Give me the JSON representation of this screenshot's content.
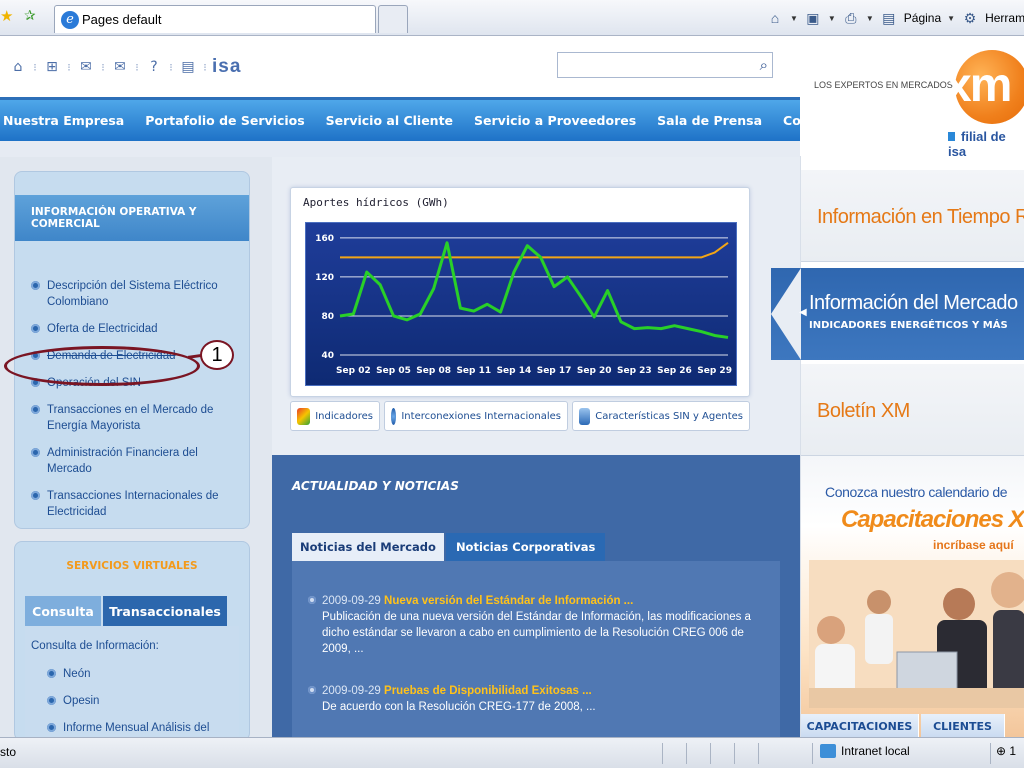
{
  "browser": {
    "tab_title": "Pages default",
    "cmd": {
      "pagina": "Página",
      "herramientas": "Herram"
    },
    "status_text": "sto",
    "zone": "Intranet local",
    "zoom": "1"
  },
  "header": {
    "isa_logo": "isa",
    "slogan": "LOS EXPERTOS EN MERCADOS",
    "brand": "xm",
    "filial": "filial de isa"
  },
  "nav": {
    "items": [
      "Nuestra Empresa",
      "Portafolio de Servicios",
      "Servicio al Cliente",
      "Servicio a Proveedores",
      "Sala de Prensa",
      "Contáctenos"
    ]
  },
  "left": {
    "panel_title": "INFORMACIÓN OPERATIVA Y COMERCIAL",
    "menu": [
      "Descripción del Sistema Eléctrico Colombiano",
      "Oferta de Electricidad",
      "Demanda de Electricidad",
      "Operación del SIN",
      "Transacciones en el Mercado de Energía Mayorista",
      "Administración Financiera del Mercado",
      "Transacciones Internacionales de Electricidad"
    ],
    "annotation": "1",
    "services_title": "SERVICIOS VIRTUALES",
    "tabs": [
      "Consulta",
      "Transaccionales"
    ],
    "consulta_label": "Consulta de Información:",
    "services": [
      "Neón",
      "Opesin",
      "Informe Mensual Análisis del"
    ]
  },
  "chart_data": {
    "type": "line",
    "title": "Aportes hídricos (GWh)",
    "categories": [
      "Sep 02",
      "Sep 05",
      "Sep 08",
      "Sep 11",
      "Sep 14",
      "Sep 17",
      "Sep 20",
      "Sep 23",
      "Sep 26",
      "Sep 29"
    ],
    "x_days": [
      1,
      2,
      3,
      4,
      5,
      6,
      7,
      8,
      9,
      10,
      11,
      12,
      13,
      14,
      15,
      16,
      17,
      18,
      19,
      20,
      21,
      22,
      23,
      24,
      25,
      26,
      27,
      28,
      29,
      30
    ],
    "yticks": [
      40,
      80,
      120,
      160
    ],
    "ylim": [
      40,
      165
    ],
    "series": [
      {
        "color": "#29d028",
        "values": [
          80,
          82,
          125,
          112,
          80,
          76,
          82,
          108,
          155,
          88,
          85,
          92,
          84,
          125,
          152,
          140,
          110,
          120,
          100,
          79,
          106,
          74,
          67,
          68,
          67,
          70,
          67,
          64,
          60,
          58
        ]
      },
      {
        "color": "#f2a516",
        "values": [
          140,
          140,
          140,
          140,
          140,
          140,
          140,
          140,
          140,
          140,
          140,
          140,
          140,
          140,
          140,
          140,
          140,
          140,
          140,
          140,
          140,
          140,
          140,
          140,
          140,
          140,
          140,
          140,
          145,
          155
        ]
      }
    ],
    "grid": true
  },
  "quick_links": [
    "Indicadores",
    "Interconexiones Internacionales",
    "Características SIN y Agentes"
  ],
  "news": {
    "section_title": "ACTUALIDAD Y NOTICIAS",
    "tabs": [
      "Noticias del Mercado",
      "Noticias Corporativas"
    ],
    "items": [
      {
        "date": "2009-09-29",
        "headline": "Nueva versión del Estándar de Información ...",
        "body": "Publicación de una nueva versión del Estándar de Información, las modificaciones a dicho estándar se llevaron a cabo en cumplimiento de la Resolución CREG 006 de 2009, ..."
      },
      {
        "date": "2009-09-29",
        "headline": "Pruebas de Disponibilidad Exitosas ...",
        "body": "De acuerdo con la Resolución CREG-177 de 2008, ..."
      }
    ]
  },
  "right": {
    "tiempo_real": "Información en Tiempo Re",
    "mercado": "Información del Mercado",
    "indicadores": "INDICADORES ENERGÉTICOS Y MÁS",
    "boletin": "Boletín XM",
    "calendario": "Conozca nuestro calendario de",
    "capacitaciones": "Capacitaciones XM",
    "inscribase": "incríbase aquí",
    "bottom_tabs": [
      "CAPACITACIONES",
      "CLIENTES"
    ]
  }
}
